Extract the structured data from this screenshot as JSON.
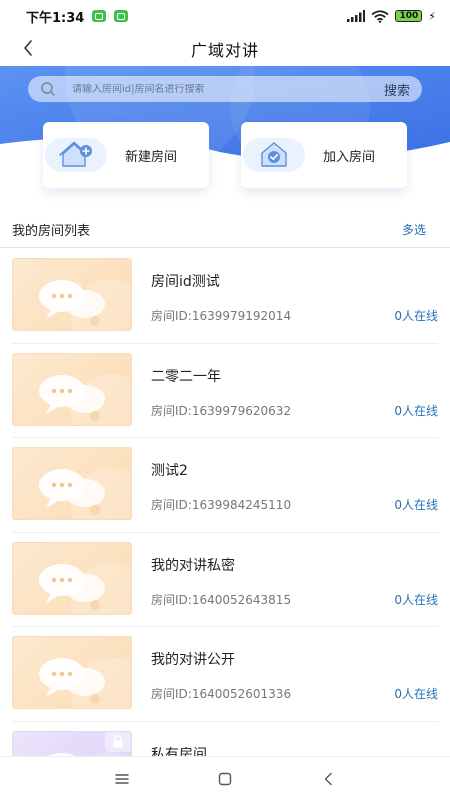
{
  "status_bar": {
    "time": "下午1:34",
    "battery": "100"
  },
  "header": {
    "title": "广域对讲"
  },
  "search": {
    "placeholder": "请输入房间id|房间名进行搜索",
    "button_label": "搜索"
  },
  "actions": {
    "create_label": "新建房间",
    "join_label": "加入房间"
  },
  "list_header": {
    "title": "我的房间列表",
    "multi_select_label": "多选"
  },
  "rooms": [
    {
      "name": "房间id测试",
      "id_text": "房间ID:1639979192014",
      "online": "0人在线",
      "thumb": "orange",
      "locked": false
    },
    {
      "name": "二零二一年",
      "id_text": "房间ID:1639979620632",
      "online": "0人在线",
      "thumb": "orange",
      "locked": false
    },
    {
      "name": "测试2",
      "id_text": "房间ID:1639984245110",
      "online": "0人在线",
      "thumb": "orange",
      "locked": false
    },
    {
      "name": "我的对讲私密",
      "id_text": "房间ID:1640052643815",
      "online": "0人在线",
      "thumb": "orange",
      "locked": false
    },
    {
      "name": "我的对讲公开",
      "id_text": "房间ID:1640052601336",
      "online": "0人在线",
      "thumb": "orange",
      "locked": false
    },
    {
      "name": "私有房间",
      "id_text": "",
      "online": "",
      "thumb": "purple",
      "locked": true
    }
  ],
  "colors": {
    "accent": "#2a6fba",
    "banner_start": "#5a8ff0",
    "banner_end": "#3d72e6"
  },
  "icons": {
    "back": "chevron-left-icon",
    "search": "search-icon",
    "create": "home-add-icon",
    "join": "home-check-icon",
    "thumb": "chat-bubbles-icon",
    "lock": "lock-icon",
    "nav_menu": "menu-icon",
    "nav_home": "square-icon",
    "nav_back": "back-arrow-icon"
  }
}
